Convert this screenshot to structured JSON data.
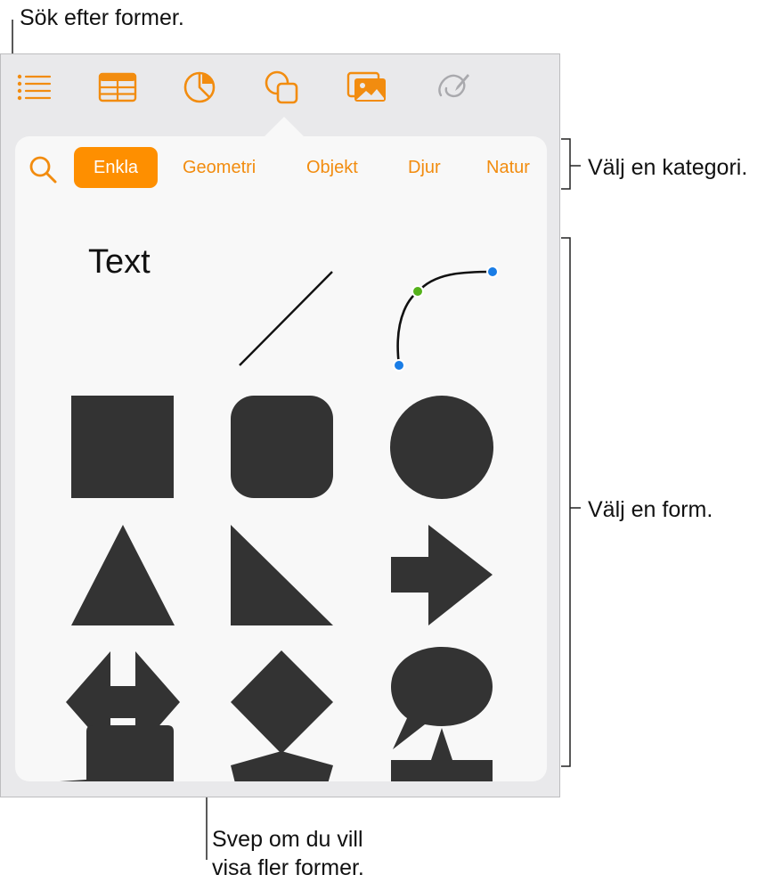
{
  "callouts": {
    "search": "Sök efter former.",
    "category": "Välj en kategori.",
    "shape": "Välj en form.",
    "swipe_line1": "Svep om du vill",
    "swipe_line2": "visa fler former."
  },
  "toolbar": {
    "items": [
      {
        "icon": "list-icon"
      },
      {
        "icon": "table-icon"
      },
      {
        "icon": "chart-icon"
      },
      {
        "icon": "shapes-icon",
        "selected": true
      },
      {
        "icon": "media-icon"
      },
      {
        "icon": "drawing-icon",
        "disabled": true
      }
    ]
  },
  "categories": {
    "items": [
      "Enkla",
      "Geometri",
      "Objekt",
      "Djur",
      "Natur"
    ],
    "selected": "Enkla"
  },
  "shapes": {
    "text_label": "Text",
    "items": [
      "text",
      "line",
      "curve",
      "square",
      "rounded-square",
      "circle",
      "triangle",
      "right-triangle",
      "arrow-right",
      "double-arrow",
      "diamond",
      "speech-bubble",
      "callout-rect",
      "pentagon",
      "star"
    ]
  },
  "colors": {
    "accent": "#fe8f00",
    "shape_fill": "#333333",
    "panel_bg": "#e9e9eb",
    "popover_bg": "#f8f8f8",
    "handle_blue": "#1a7de6",
    "handle_green": "#55b21b"
  }
}
